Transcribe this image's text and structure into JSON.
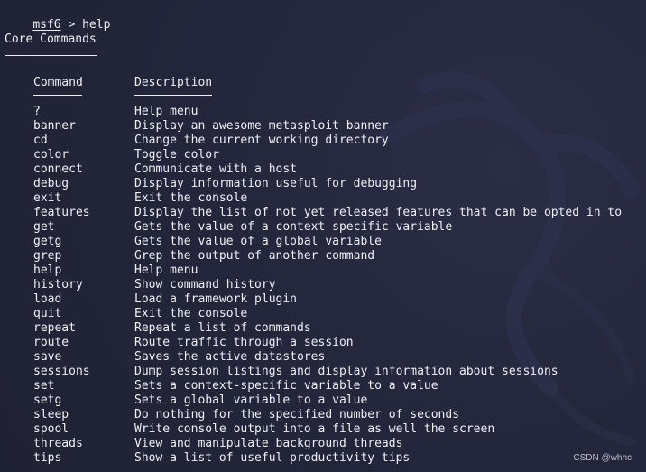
{
  "terminal": {
    "prompt_prefix": "msf6",
    "prompt_rest": " > help",
    "section_title": "Core Commands",
    "headers": {
      "command": "Command",
      "description": "Description"
    },
    "commands": [
      {
        "name": "?",
        "description": "Help menu"
      },
      {
        "name": "banner",
        "description": "Display an awesome metasploit banner"
      },
      {
        "name": "cd",
        "description": "Change the current working directory"
      },
      {
        "name": "color",
        "description": "Toggle color"
      },
      {
        "name": "connect",
        "description": "Communicate with a host"
      },
      {
        "name": "debug",
        "description": "Display information useful for debugging"
      },
      {
        "name": "exit",
        "description": "Exit the console"
      },
      {
        "name": "features",
        "description": "Display the list of not yet released features that can be opted in to"
      },
      {
        "name": "get",
        "description": "Gets the value of a context-specific variable"
      },
      {
        "name": "getg",
        "description": "Gets the value of a global variable"
      },
      {
        "name": "grep",
        "description": "Grep the output of another command"
      },
      {
        "name": "help",
        "description": "Help menu"
      },
      {
        "name": "history",
        "description": "Show command history"
      },
      {
        "name": "load",
        "description": "Load a framework plugin"
      },
      {
        "name": "quit",
        "description": "Exit the console"
      },
      {
        "name": "repeat",
        "description": "Repeat a list of commands"
      },
      {
        "name": "route",
        "description": "Route traffic through a session"
      },
      {
        "name": "save",
        "description": "Saves the active datastores"
      },
      {
        "name": "sessions",
        "description": "Dump session listings and display information about sessions"
      },
      {
        "name": "set",
        "description": "Sets a context-specific variable to a value"
      },
      {
        "name": "setg",
        "description": "Sets a global variable to a value"
      },
      {
        "name": "sleep",
        "description": "Do nothing for the specified number of seconds"
      },
      {
        "name": "spool",
        "description": "Write console output into a file as well the screen"
      },
      {
        "name": "threads",
        "description": "View and manipulate background threads"
      },
      {
        "name": "tips",
        "description": "Show a list of useful productivity tips"
      }
    ]
  },
  "watermark": "CSDN @whhc",
  "colors": {
    "background": "#23263a",
    "text": "#eef0f6"
  },
  "icons": {
    "background_logo": "kali-dragon-logo"
  }
}
